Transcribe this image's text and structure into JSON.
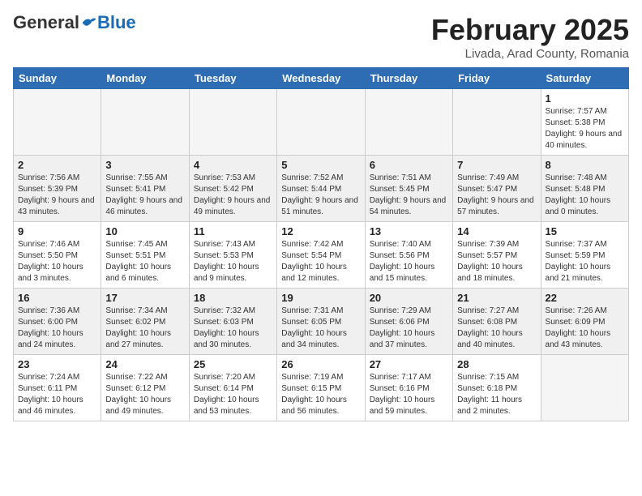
{
  "header": {
    "logo_general": "General",
    "logo_blue": "Blue",
    "month_title": "February 2025",
    "location": "Livada, Arad County, Romania"
  },
  "weekdays": [
    "Sunday",
    "Monday",
    "Tuesday",
    "Wednesday",
    "Thursday",
    "Friday",
    "Saturday"
  ],
  "weeks": [
    [
      {
        "day": "",
        "info": ""
      },
      {
        "day": "",
        "info": ""
      },
      {
        "day": "",
        "info": ""
      },
      {
        "day": "",
        "info": ""
      },
      {
        "day": "",
        "info": ""
      },
      {
        "day": "",
        "info": ""
      },
      {
        "day": "1",
        "info": "Sunrise: 7:57 AM\nSunset: 5:38 PM\nDaylight: 9 hours and 40 minutes."
      }
    ],
    [
      {
        "day": "2",
        "info": "Sunrise: 7:56 AM\nSunset: 5:39 PM\nDaylight: 9 hours and 43 minutes."
      },
      {
        "day": "3",
        "info": "Sunrise: 7:55 AM\nSunset: 5:41 PM\nDaylight: 9 hours and 46 minutes."
      },
      {
        "day": "4",
        "info": "Sunrise: 7:53 AM\nSunset: 5:42 PM\nDaylight: 9 hours and 49 minutes."
      },
      {
        "day": "5",
        "info": "Sunrise: 7:52 AM\nSunset: 5:44 PM\nDaylight: 9 hours and 51 minutes."
      },
      {
        "day": "6",
        "info": "Sunrise: 7:51 AM\nSunset: 5:45 PM\nDaylight: 9 hours and 54 minutes."
      },
      {
        "day": "7",
        "info": "Sunrise: 7:49 AM\nSunset: 5:47 PM\nDaylight: 9 hours and 57 minutes."
      },
      {
        "day": "8",
        "info": "Sunrise: 7:48 AM\nSunset: 5:48 PM\nDaylight: 10 hours and 0 minutes."
      }
    ],
    [
      {
        "day": "9",
        "info": "Sunrise: 7:46 AM\nSunset: 5:50 PM\nDaylight: 10 hours and 3 minutes."
      },
      {
        "day": "10",
        "info": "Sunrise: 7:45 AM\nSunset: 5:51 PM\nDaylight: 10 hours and 6 minutes."
      },
      {
        "day": "11",
        "info": "Sunrise: 7:43 AM\nSunset: 5:53 PM\nDaylight: 10 hours and 9 minutes."
      },
      {
        "day": "12",
        "info": "Sunrise: 7:42 AM\nSunset: 5:54 PM\nDaylight: 10 hours and 12 minutes."
      },
      {
        "day": "13",
        "info": "Sunrise: 7:40 AM\nSunset: 5:56 PM\nDaylight: 10 hours and 15 minutes."
      },
      {
        "day": "14",
        "info": "Sunrise: 7:39 AM\nSunset: 5:57 PM\nDaylight: 10 hours and 18 minutes."
      },
      {
        "day": "15",
        "info": "Sunrise: 7:37 AM\nSunset: 5:59 PM\nDaylight: 10 hours and 21 minutes."
      }
    ],
    [
      {
        "day": "16",
        "info": "Sunrise: 7:36 AM\nSunset: 6:00 PM\nDaylight: 10 hours and 24 minutes."
      },
      {
        "day": "17",
        "info": "Sunrise: 7:34 AM\nSunset: 6:02 PM\nDaylight: 10 hours and 27 minutes."
      },
      {
        "day": "18",
        "info": "Sunrise: 7:32 AM\nSunset: 6:03 PM\nDaylight: 10 hours and 30 minutes."
      },
      {
        "day": "19",
        "info": "Sunrise: 7:31 AM\nSunset: 6:05 PM\nDaylight: 10 hours and 34 minutes."
      },
      {
        "day": "20",
        "info": "Sunrise: 7:29 AM\nSunset: 6:06 PM\nDaylight: 10 hours and 37 minutes."
      },
      {
        "day": "21",
        "info": "Sunrise: 7:27 AM\nSunset: 6:08 PM\nDaylight: 10 hours and 40 minutes."
      },
      {
        "day": "22",
        "info": "Sunrise: 7:26 AM\nSunset: 6:09 PM\nDaylight: 10 hours and 43 minutes."
      }
    ],
    [
      {
        "day": "23",
        "info": "Sunrise: 7:24 AM\nSunset: 6:11 PM\nDaylight: 10 hours and 46 minutes."
      },
      {
        "day": "24",
        "info": "Sunrise: 7:22 AM\nSunset: 6:12 PM\nDaylight: 10 hours and 49 minutes."
      },
      {
        "day": "25",
        "info": "Sunrise: 7:20 AM\nSunset: 6:14 PM\nDaylight: 10 hours and 53 minutes."
      },
      {
        "day": "26",
        "info": "Sunrise: 7:19 AM\nSunset: 6:15 PM\nDaylight: 10 hours and 56 minutes."
      },
      {
        "day": "27",
        "info": "Sunrise: 7:17 AM\nSunset: 6:16 PM\nDaylight: 10 hours and 59 minutes."
      },
      {
        "day": "28",
        "info": "Sunrise: 7:15 AM\nSunset: 6:18 PM\nDaylight: 11 hours and 2 minutes."
      },
      {
        "day": "",
        "info": ""
      }
    ]
  ]
}
